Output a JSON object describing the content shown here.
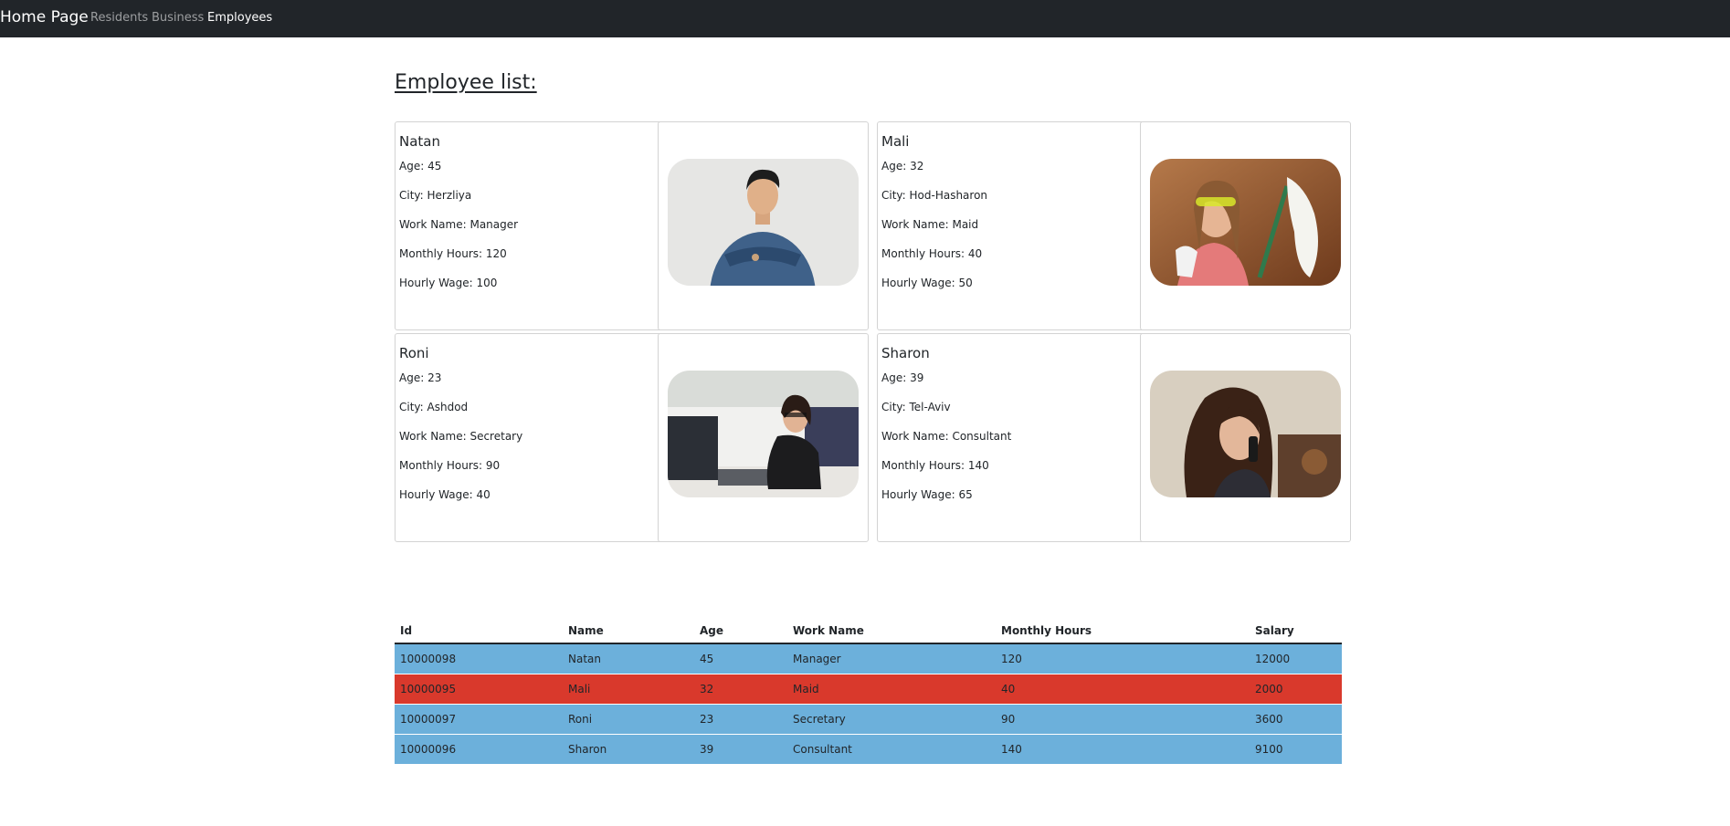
{
  "nav": {
    "brand": "Home Page",
    "links": [
      {
        "label": "Residents",
        "active": false
      },
      {
        "label": "Business",
        "active": false
      },
      {
        "label": "Employees",
        "active": true
      }
    ]
  },
  "page": {
    "title": "Employee list:"
  },
  "employees": [
    {
      "name": "Natan",
      "age": "Age: 45",
      "city": "City: Herzliya",
      "work": "Work Name: Manager",
      "hours": "Monthly Hours: 120",
      "wage": "Hourly Wage: 100",
      "photo_icon": "man-crossed-arms-photo"
    },
    {
      "name": "Mali",
      "age": "Age: 32",
      "city": "City: Hod-Hasharon",
      "work": "Work Name: Maid",
      "hours": "Monthly Hours: 40",
      "wage": "Hourly Wage: 50",
      "photo_icon": "woman-with-mop-photo"
    },
    {
      "name": "Roni",
      "age": "Age: 23",
      "city": "City: Ashdod",
      "work": "Work Name: Secretary",
      "hours": "Monthly Hours: 90",
      "wage": "Hourly Wage: 40",
      "photo_icon": "woman-at-computer-photo"
    },
    {
      "name": "Sharon",
      "age": "Age: 39",
      "city": "City: Tel-Aviv",
      "work": "Work Name: Consultant",
      "hours": "Monthly Hours: 140",
      "wage": "Hourly Wage: 65",
      "photo_icon": "woman-on-phone-photo"
    }
  ],
  "table": {
    "headers": [
      "Id",
      "Name",
      "Age",
      "Work Name",
      "Monthly Hours",
      "Salary"
    ],
    "rows": [
      {
        "id": "10000098",
        "name": "Natan",
        "age": "45",
        "work": "Manager",
        "hours": "120",
        "salary": "12000",
        "color": "#6cb0db"
      },
      {
        "id": "10000095",
        "name": "Mali",
        "age": "32",
        "work": "Maid",
        "hours": "40",
        "salary": "2000",
        "color": "#d9392c"
      },
      {
        "id": "10000097",
        "name": "Roni",
        "age": "23",
        "work": "Secretary",
        "hours": "90",
        "salary": "3600",
        "color": "#6cb0db"
      },
      {
        "id": "10000096",
        "name": "Sharon",
        "age": "39",
        "work": "Consultant",
        "hours": "140",
        "salary": "9100",
        "color": "#6cb0db"
      }
    ]
  },
  "colors": {
    "navbar_bg": "#212529",
    "row_blue": "#6cb0db",
    "row_red": "#d9392c"
  }
}
